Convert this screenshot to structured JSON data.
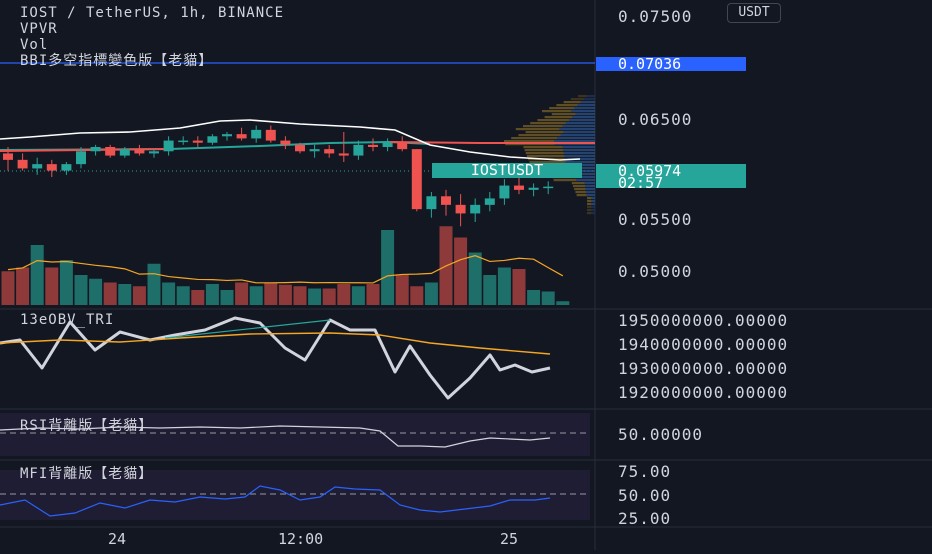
{
  "legend": {
    "symbol_line": "IOST / TetherUS, 1h, BINANCE",
    "indicator1": "VPVR",
    "indicator2": "Vol",
    "indicator3": "BBI多空指標變色版【老貓】"
  },
  "currency_badge": "USDT",
  "price_axis": {
    "labels": [
      "0.07500",
      "0.06500",
      "0.05500",
      "0.05000"
    ],
    "high_line_price": "0.07036",
    "current_price": "0.05974",
    "countdown": "02:57",
    "symbol_tag": "IOSTUSDT"
  },
  "obv_pane": {
    "title": "13eOBV_TRI",
    "labels": [
      "1950000000.00000",
      "1940000000.00000",
      "1930000000.00000",
      "1920000000.00000"
    ]
  },
  "rsi_pane": {
    "title": "RSI背離版【老貓】",
    "label": "50.00000"
  },
  "mfi_pane": {
    "title": "MFI背離版【老貓】",
    "labels": [
      "75.00",
      "50.00",
      "25.00"
    ]
  },
  "time_axis": [
    "24",
    "12:00",
    "25"
  ],
  "colors": {
    "background": "#131722",
    "up": "#26a69a",
    "down": "#ef5350",
    "accent_blue": "#2962ff",
    "orange": "#f5a623"
  },
  "chart_data": {
    "type": "candlestick",
    "title": "IOST / TetherUS, 1h, BINANCE",
    "candles": [
      {
        "o": 0.0628,
        "h": 0.0634,
        "l": 0.0612,
        "c": 0.0622
      },
      {
        "o": 0.0622,
        "h": 0.0628,
        "l": 0.0612,
        "c": 0.0614
      },
      {
        "o": 0.0614,
        "h": 0.0624,
        "l": 0.0608,
        "c": 0.0618
      },
      {
        "o": 0.0618,
        "h": 0.0622,
        "l": 0.0606,
        "c": 0.0612
      },
      {
        "o": 0.0612,
        "h": 0.062,
        "l": 0.0608,
        "c": 0.0618
      },
      {
        "o": 0.0618,
        "h": 0.0634,
        "l": 0.0614,
        "c": 0.063
      },
      {
        "o": 0.063,
        "h": 0.0636,
        "l": 0.0626,
        "c": 0.0634
      },
      {
        "o": 0.0634,
        "h": 0.0636,
        "l": 0.0624,
        "c": 0.0626
      },
      {
        "o": 0.0626,
        "h": 0.0634,
        "l": 0.0624,
        "c": 0.0632
      },
      {
        "o": 0.0632,
        "h": 0.0636,
        "l": 0.0626,
        "c": 0.0628
      },
      {
        "o": 0.0628,
        "h": 0.0632,
        "l": 0.0624,
        "c": 0.063
      },
      {
        "o": 0.063,
        "h": 0.0644,
        "l": 0.0626,
        "c": 0.064
      },
      {
        "o": 0.064,
        "h": 0.0644,
        "l": 0.0636,
        "c": 0.064
      },
      {
        "o": 0.064,
        "h": 0.0644,
        "l": 0.0634,
        "c": 0.0638
      },
      {
        "o": 0.0638,
        "h": 0.0646,
        "l": 0.0636,
        "c": 0.0644
      },
      {
        "o": 0.0644,
        "h": 0.0648,
        "l": 0.064,
        "c": 0.0646
      },
      {
        "o": 0.0646,
        "h": 0.0652,
        "l": 0.064,
        "c": 0.0642
      },
      {
        "o": 0.0642,
        "h": 0.0654,
        "l": 0.0638,
        "c": 0.065
      },
      {
        "o": 0.065,
        "h": 0.0654,
        "l": 0.0638,
        "c": 0.064
      },
      {
        "o": 0.064,
        "h": 0.0644,
        "l": 0.0632,
        "c": 0.0636
      },
      {
        "o": 0.0636,
        "h": 0.0638,
        "l": 0.0628,
        "c": 0.063
      },
      {
        "o": 0.063,
        "h": 0.0636,
        "l": 0.0624,
        "c": 0.0632
      },
      {
        "o": 0.0632,
        "h": 0.0636,
        "l": 0.0624,
        "c": 0.0628
      },
      {
        "o": 0.0628,
        "h": 0.0648,
        "l": 0.062,
        "c": 0.0626
      },
      {
        "o": 0.0626,
        "h": 0.064,
        "l": 0.0622,
        "c": 0.0636
      },
      {
        "o": 0.0636,
        "h": 0.0642,
        "l": 0.063,
        "c": 0.0634
      },
      {
        "o": 0.0634,
        "h": 0.0642,
        "l": 0.063,
        "c": 0.0638
      },
      {
        "o": 0.0638,
        "h": 0.0644,
        "l": 0.063,
        "c": 0.0632
      },
      {
        "o": 0.0632,
        "h": 0.0632,
        "l": 0.0574,
        "c": 0.0576
      },
      {
        "o": 0.0576,
        "h": 0.0592,
        "l": 0.0568,
        "c": 0.0588
      },
      {
        "o": 0.0588,
        "h": 0.0594,
        "l": 0.057,
        "c": 0.058
      },
      {
        "o": 0.058,
        "h": 0.059,
        "l": 0.056,
        "c": 0.0572
      },
      {
        "o": 0.0572,
        "h": 0.0586,
        "l": 0.0564,
        "c": 0.058
      },
      {
        "o": 0.058,
        "h": 0.0592,
        "l": 0.0574,
        "c": 0.0586
      },
      {
        "o": 0.0586,
        "h": 0.0604,
        "l": 0.058,
        "c": 0.0598
      },
      {
        "o": 0.0598,
        "h": 0.0606,
        "l": 0.059,
        "c": 0.0594
      },
      {
        "o": 0.0594,
        "h": 0.06,
        "l": 0.0588,
        "c": 0.0596
      },
      {
        "o": 0.0596,
        "h": 0.0602,
        "l": 0.059,
        "c": 0.0597
      }
    ],
    "volume_relative": [
      0.45,
      0.5,
      0.8,
      0.5,
      0.6,
      0.4,
      0.35,
      0.3,
      0.28,
      0.25,
      0.55,
      0.3,
      0.25,
      0.2,
      0.28,
      0.2,
      0.3,
      0.25,
      0.3,
      0.27,
      0.25,
      0.22,
      0.22,
      0.28,
      0.25,
      0.28,
      1.0,
      0.4,
      0.25,
      0.3,
      1.05,
      0.9,
      0.7,
      0.4,
      0.5,
      0.48,
      0.2,
      0.18,
      0.05
    ],
    "ylim": [
      0.048,
      0.076
    ]
  }
}
